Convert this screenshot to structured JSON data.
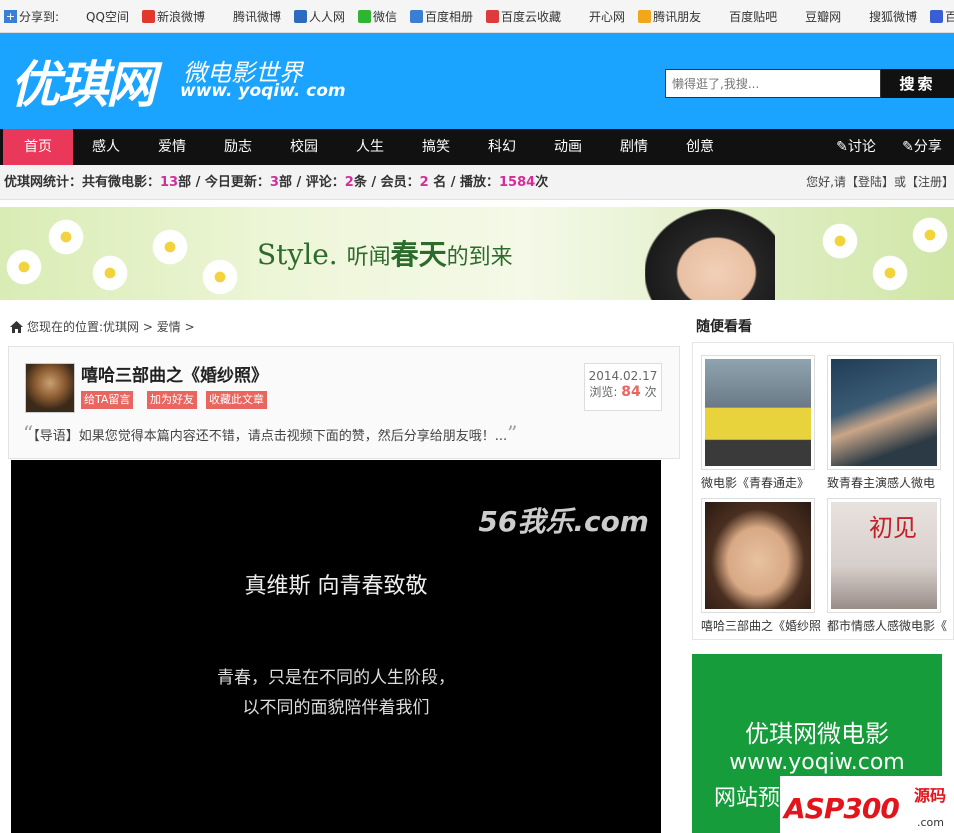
{
  "sharebar": {
    "lead": "分享到:",
    "items": [
      {
        "label": "QQ空间",
        "icon": "qzone-icon",
        "color": "#f5f5f5"
      },
      {
        "label": "新浪微博",
        "icon": "weibo-icon",
        "color": "#e2372b"
      },
      {
        "label": "腾讯微博",
        "icon": "tencent-weibo-icon",
        "color": "#f5f5f5"
      },
      {
        "label": "人人网",
        "icon": "renren-icon",
        "color": "#2c6bbf"
      },
      {
        "label": "微信",
        "icon": "wechat-icon",
        "color": "#2fb52f"
      },
      {
        "label": "百度相册",
        "icon": "baidu-album-icon",
        "color": "#3a7fd5"
      },
      {
        "label": "百度云收藏",
        "icon": "baidu-cloud-icon",
        "color": "#e03b3b"
      },
      {
        "label": "开心网",
        "icon": "kaixin-icon",
        "color": "#f5f5f5"
      },
      {
        "label": "腾讯朋友",
        "icon": "pengyou-icon",
        "color": "#f2a71a"
      },
      {
        "label": "百度贴吧",
        "icon": "tieba-icon",
        "color": "#f5f5f5"
      },
      {
        "label": "豆瓣网",
        "icon": "douban-icon",
        "color": "#f5f5f5"
      },
      {
        "label": "搜狐微博",
        "icon": "sohu-weibo-icon",
        "color": "#f5f5f5"
      },
      {
        "label": "百度新首页",
        "icon": "baidu-home-icon",
        "color": "#3a5fd5"
      }
    ]
  },
  "header": {
    "logo": "优琪网",
    "slogan": "微电影世界",
    "url": "www. yoqiw. com",
    "search_placeholder": "懒得逛了,我搜...",
    "search_button": "搜索"
  },
  "nav": {
    "items": [
      "首页",
      "感人",
      "爱情",
      "励志",
      "校园",
      "人生",
      "搞笑",
      "科幻",
      "动画",
      "剧情",
      "创意"
    ],
    "discuss": "✎讨论",
    "share": "✎分享"
  },
  "stats": {
    "label": "优琪网统计：共有微电影：",
    "films": "13",
    "films_unit": "部 / 今日更新：",
    "today": "3",
    "today_unit": "部 / 评论：",
    "comments": "2",
    "comments_unit": "条 / 会员：",
    "members": "2",
    "members_unit": " 名 / 播放：",
    "plays": "1584",
    "plays_unit": "次",
    "login_hint": "您好,请【登陆】或【注册】"
  },
  "banner": {
    "style_word": "Style.",
    "tagline_a": "听闻",
    "tagline_b": "春天",
    "tagline_c": "的到来"
  },
  "breadcrumb": {
    "prefix": "您现在的位置:",
    "site": "优琪网",
    "sep1": ">",
    "category": "爱情",
    "sep2": ">"
  },
  "article": {
    "title": "嘻哈三部曲之《婚纱照》",
    "buttons": [
      "给TA留言",
      "加为好友",
      "收藏此文章"
    ],
    "date": "2014.02.17",
    "views_label": "浏览:",
    "views": "84",
    "views_unit": "次",
    "intro": "【导语】如果您觉得本篇内容还不错，请点击视频下面的赞，然后分享给朋友哦！..."
  },
  "video": {
    "watermark": "56我乐.com",
    "line1": "真维斯  向青春致敬",
    "line2": "青春，只是在不同的人生阶段，",
    "line3": "以不同的面貌陪伴着我们"
  },
  "sidebar": {
    "title": "随便看看",
    "items": [
      {
        "caption": "微电影《青春通走》"
      },
      {
        "caption": "致青春主演感人微电"
      },
      {
        "caption": "嘻哈三部曲之《婚纱照"
      },
      {
        "caption": "都市情感人感微电影《"
      }
    ],
    "thumb_text": "初见"
  },
  "ad": {
    "line1": "优琪网微电影",
    "line2": "www.yoqiw.com",
    "line3": "网站预"
  },
  "footer_logo": {
    "text": "ASP300",
    "suffix": "源码",
    "domain": ".com"
  }
}
